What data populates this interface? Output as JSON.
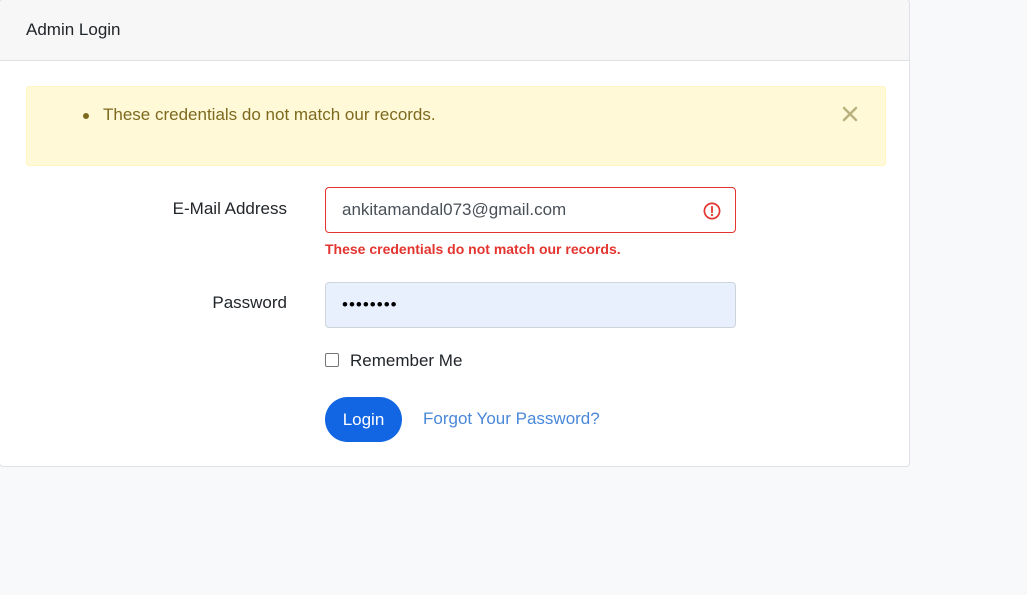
{
  "card": {
    "title": "Admin Login"
  },
  "alert": {
    "messages": [
      "These credentials do not match our records."
    ],
    "close_icon": "close-icon"
  },
  "form": {
    "email_label": "E-Mail Address",
    "email_value": "ankitamandal073@gmail.com",
    "email_error": "These credentials do not match our records.",
    "error_icon": "exclamation-circle-icon",
    "password_label": "Password",
    "password_value": "••••••••",
    "remember_label": "Remember Me",
    "login_label": "Login",
    "forgot_label": "Forgot Your Password?"
  },
  "colors": {
    "primary": "#1266e3",
    "danger": "#e3342f",
    "alert_bg": "#fff9d8",
    "alert_text": "#7d6a1e",
    "link": "#4a88d9"
  }
}
